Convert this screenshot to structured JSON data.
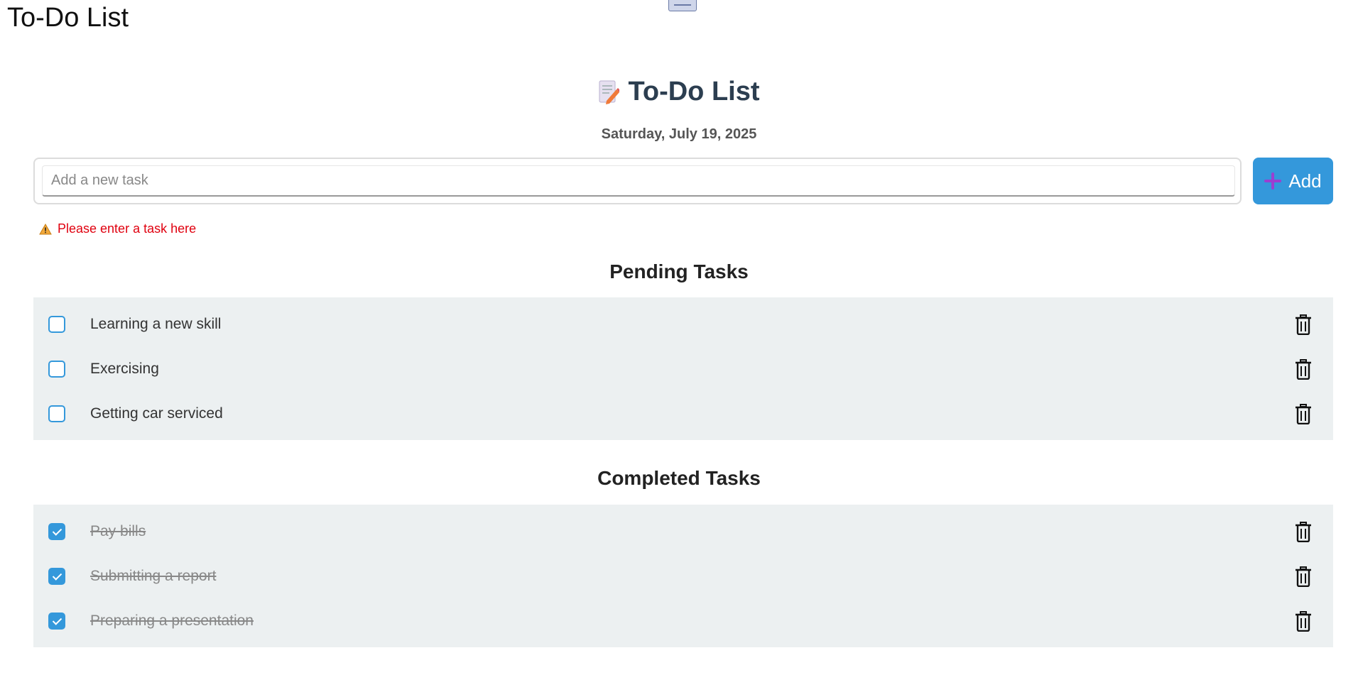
{
  "window": {
    "title": "To-Do List"
  },
  "header": {
    "title": "To-Do List",
    "icon": "memo-icon",
    "date": "Saturday, July 19, 2025"
  },
  "input": {
    "placeholder": "Add a new task",
    "value": "",
    "add_label": "Add",
    "add_icon": "plus-icon"
  },
  "error": {
    "icon": "warning-icon",
    "message": "Please enter a task here"
  },
  "pending": {
    "title": "Pending Tasks",
    "tasks": [
      {
        "label": "Learning a new skill",
        "checked": false
      },
      {
        "label": "Exercising",
        "checked": false
      },
      {
        "label": "Getting car serviced",
        "checked": false
      }
    ]
  },
  "completed": {
    "title": "Completed Tasks",
    "tasks": [
      {
        "label": "Pay bills",
        "checked": true
      },
      {
        "label": "Submitting a report",
        "checked": true
      },
      {
        "label": "Preparing a presentation",
        "checked": true
      }
    ]
  },
  "colors": {
    "accent": "#3498db",
    "heading": "#2c3e50",
    "list_bg": "#ecf0f1",
    "error": "#e0000f"
  }
}
